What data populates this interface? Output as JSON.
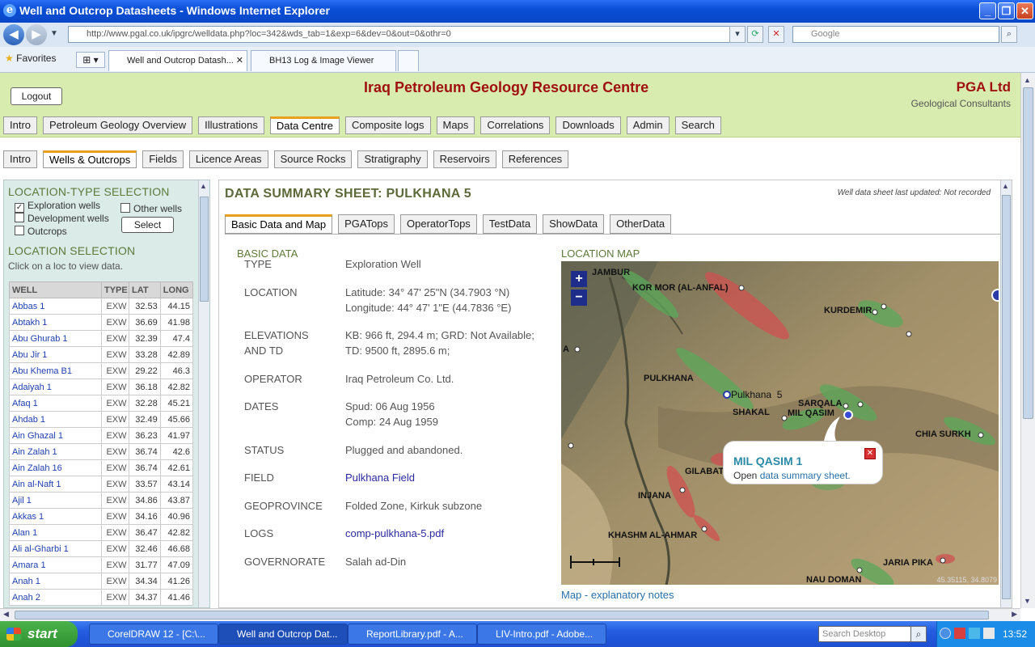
{
  "window": {
    "title": "Well and Outcrop Datasheets - Windows Internet Explorer"
  },
  "browser": {
    "url": "http://www.pgal.co.uk/ipgrc/welldata.php?loc=342&wds_tab=1&exp=6&dev=0&out=0&othr=0",
    "search_placeholder": "Google",
    "favorites_label": "Favorites",
    "tabs": [
      "Well and Outcrop Datash...",
      "BH13 Log & Image Viewer"
    ]
  },
  "site": {
    "title": "Iraq Petroleum Geology Resource Centre",
    "company": "PGA Ltd",
    "company_sub": "Geological Consultants",
    "logout": "Logout",
    "menu1": [
      "Intro",
      "Petroleum Geology Overview",
      "Illustrations",
      "Data Centre",
      "Composite logs",
      "Maps",
      "Correlations",
      "Downloads",
      "Admin",
      "Search"
    ],
    "menu2": [
      "Intro",
      "Wells & Outcrops",
      "Fields",
      "Licence Areas",
      "Source Rocks",
      "Stratigraphy",
      "Reservoirs",
      "References"
    ]
  },
  "left": {
    "type_heading": "LOCATION-TYPE SELECTION",
    "opt_exploration": "Exploration wells",
    "opt_other": "Other wells",
    "opt_development": "Development wells",
    "opt_outcrops": "Outcrops",
    "select_btn": "Select",
    "loc_heading": "LOCATION SELECTION",
    "loc_hint": "Click on a loc to view data.",
    "columns": [
      "WELL",
      "TYPE",
      "LAT",
      "LONG"
    ],
    "wells": [
      [
        "Abbas 1",
        "EXW",
        "32.53",
        "44.15"
      ],
      [
        "Abtakh 1",
        "EXW",
        "36.69",
        "41.98"
      ],
      [
        "Abu Ghurab 1",
        "EXW",
        "32.39",
        "47.4"
      ],
      [
        "Abu Jir 1",
        "EXW",
        "33.28",
        "42.89"
      ],
      [
        "Abu Khema B1",
        "EXW",
        "29.22",
        "46.3"
      ],
      [
        "Adaiyah 1",
        "EXW",
        "36.18",
        "42.82"
      ],
      [
        "Afaq 1",
        "EXW",
        "32.28",
        "45.21"
      ],
      [
        "Ahdab 1",
        "EXW",
        "32.49",
        "45.66"
      ],
      [
        "Ain Ghazal 1",
        "EXW",
        "36.23",
        "41.97"
      ],
      [
        "Ain Zalah 1",
        "EXW",
        "36.74",
        "42.6"
      ],
      [
        "Ain Zalah 16",
        "EXW",
        "36.74",
        "42.61"
      ],
      [
        "Ain al-Naft 1",
        "EXW",
        "33.57",
        "43.14"
      ],
      [
        "Ajil 1",
        "EXW",
        "34.86",
        "43.87"
      ],
      [
        "Akkas 1",
        "EXW",
        "34.16",
        "40.96"
      ],
      [
        "Alan 1",
        "EXW",
        "36.47",
        "42.82"
      ],
      [
        "Ali al-Gharbi 1",
        "EXW",
        "32.46",
        "46.68"
      ],
      [
        "Amara 1",
        "EXW",
        "31.77",
        "47.09"
      ],
      [
        "Anah 1",
        "EXW",
        "34.34",
        "41.26"
      ],
      [
        "Anah 2",
        "EXW",
        "34.37",
        "41.46"
      ]
    ]
  },
  "sheet": {
    "title": "DATA SUMMARY SHEET: PULKHANA 5",
    "updated": "Well data sheet last updated: Not recorded",
    "tabs": [
      "Basic Data and Map",
      "PGATops",
      "OperatorTops",
      "TestData",
      "ShowData",
      "OtherData"
    ],
    "basic_heading": "BASIC DATA",
    "type_label": "TYPE",
    "type_value": "Exploration Well",
    "location_label": "LOCATION",
    "lat": "Latitude: 34° 47' 25\"N (34.7903 °N)",
    "lon": "Longitude: 44° 47' 1\"E (44.7836 °E)",
    "elev_label1": "ELEVATIONS",
    "elev_label2": "AND TD",
    "elev1": "KB: 966 ft, 294.4 m; GRD: Not Available;",
    "elev2": "TD: 9500 ft, 2895.6 m;",
    "operator_label": "OPERATOR",
    "operator": "Iraq Petroleum Co. Ltd.",
    "dates_label": "DATES",
    "spud": "Spud: 06 Aug 1956",
    "comp": "Comp: 24 Aug 1959",
    "status_label": "STATUS",
    "status": "Plugged and abandoned.",
    "field_label": "FIELD",
    "field": "Pulkhana Field",
    "geo_label": "GEOPROVINCE",
    "geo": "Folded Zone, Kirkuk subzone",
    "logs_label": "LOGS",
    "logs": "comp-pulkhana-5.pdf",
    "gov_label": "GOVERNORATE",
    "gov": "Salah ad-Din",
    "map_heading": "LOCATION MAP",
    "map_notes": "Map - explanatory notes",
    "map_labels": [
      "JAMBUR",
      "KOR MOR (AL-ANFAL)",
      "KURDEMIR",
      "PULKHANA",
      "Pulkhana  5",
      "SARQALA",
      "SHAKAL",
      "MIL QASIM",
      "CHIA SURKH",
      "GILABAT",
      "INJANA",
      "KHASHM AL-AHMAR",
      "JARIA PIKA",
      "NAU DOMAN",
      "A"
    ],
    "map_coord": "45.35115, 34.8079",
    "popup_title": "MIL QASIM 1",
    "popup_text": "Open",
    "popup_link": "data summary sheet."
  },
  "taskbar": {
    "start": "start",
    "tasks": [
      "CorelDRAW 12 - [C:\\...",
      "Well and Outcrop Dat...",
      "ReportLibrary.pdf - A...",
      "LIV-Intro.pdf - Adobe..."
    ],
    "search": "Search Desktop",
    "time": "13:52"
  }
}
